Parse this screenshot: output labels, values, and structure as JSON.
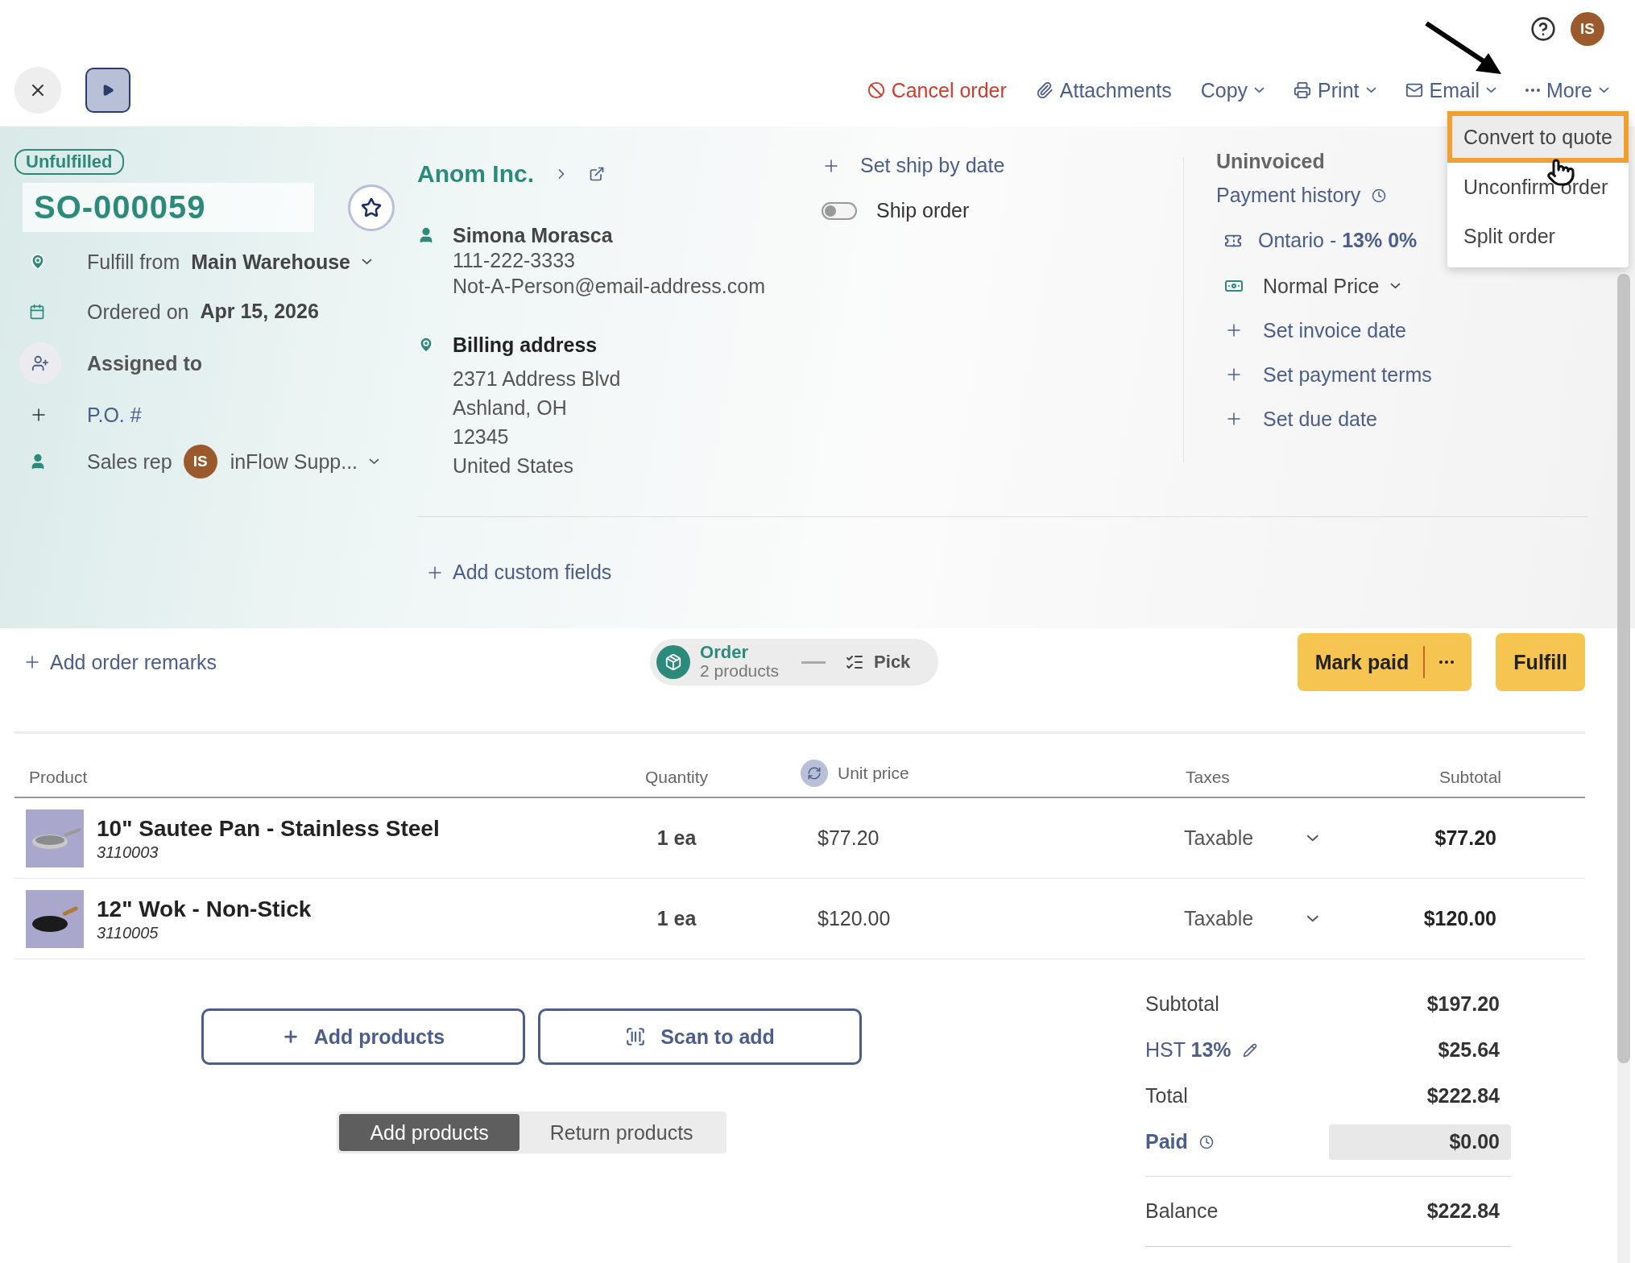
{
  "top_bar": {
    "avatar": "IS"
  },
  "toolbar": {
    "actions": [
      {
        "label": "Cancel order",
        "kind": "cancel"
      },
      {
        "label": "Attachments",
        "kind": "attach"
      },
      {
        "label": "Copy",
        "kind": "copy"
      },
      {
        "label": "Print",
        "kind": "print"
      },
      {
        "label": "Email",
        "kind": "email"
      },
      {
        "label": "More",
        "kind": "more"
      }
    ]
  },
  "more_menu": {
    "items": [
      {
        "label": "Convert to quote",
        "selected": true
      },
      {
        "label": "Unconfirm order",
        "selected": false
      },
      {
        "label": "Split order",
        "selected": false
      }
    ]
  },
  "order": {
    "status": "Unfulfilled",
    "number": "SO-000059",
    "starred": false,
    "fulfill_from": {
      "label": "Fulfill from",
      "value": "Main Warehouse"
    },
    "ordered_on": {
      "label": "Ordered on",
      "value": "Apr 15, 2026"
    },
    "assigned_to": {
      "label": "Assigned to"
    },
    "po": {
      "label": "P.O. #"
    },
    "sales_rep": {
      "label": "Sales rep",
      "initials": "IS",
      "value": "inFlow Supp..."
    }
  },
  "customer": {
    "name": "Anom Inc.",
    "contact": "Simona Morasca",
    "phone": "111-222-3333",
    "email": "Not-A-Person@email-address.com",
    "billing": {
      "label": "Billing address",
      "lines": [
        "2371 Address Blvd",
        "Ashland, OH",
        "12345",
        "United States"
      ]
    }
  },
  "shipping": {
    "set_date": "Set ship by date",
    "ship_order": {
      "label": "Ship order",
      "on": false
    }
  },
  "invoice": {
    "status": "Uninvoiced",
    "payment_history": "Payment history",
    "tax": "Ontario - **13% 0%**",
    "pricing": "Normal Price",
    "links": [
      "Set invoice date",
      "Set payment terms",
      "Set due date"
    ]
  },
  "custom_fields": "Add custom fields",
  "remarks": "Add order remarks",
  "stepper": [
    {
      "title": "Order",
      "subtitle": "2 products",
      "selected": true
    },
    {
      "title": "Pick",
      "selected": false
    }
  ],
  "actions": {
    "mark_paid": "Mark paid",
    "fulfill": "Fulfill"
  },
  "table": {
    "columns": [
      "Product",
      "Quantity",
      "Unit price",
      "Taxes",
      "Subtotal"
    ],
    "rows": [
      {
        "name": "10\" Sautee Pan - Stainless Steel",
        "sku": "3110003",
        "quantity": "1 ea",
        "unit_price": "$77.20",
        "taxes": "Taxable",
        "subtotal": "$77.20",
        "kind": "pan"
      },
      {
        "name": "12\" Wok - Non-Stick",
        "sku": "3110005",
        "quantity": "1 ea",
        "unit_price": "$120.00",
        "taxes": "Taxable",
        "subtotal": "$120.00",
        "kind": "wok"
      }
    ]
  },
  "add_buttons": [
    "Add products",
    "Scan to add"
  ],
  "mode_tabs": [
    {
      "label": "Add products",
      "selected": true
    },
    {
      "label": "Return products",
      "selected": false
    }
  ],
  "totals": [
    {
      "label": "Subtotal",
      "value": "$197.20",
      "kind": "plain"
    },
    {
      "label": "HST **13%**",
      "value": "$25.64",
      "kind": "tax"
    },
    {
      "label": "Total",
      "value": "$222.84",
      "kind": "plain"
    },
    {
      "label": "Paid",
      "value": "$0.00",
      "kind": "paid"
    },
    {
      "label": "Balance",
      "value": "$222.84",
      "kind": "balance"
    }
  ]
}
